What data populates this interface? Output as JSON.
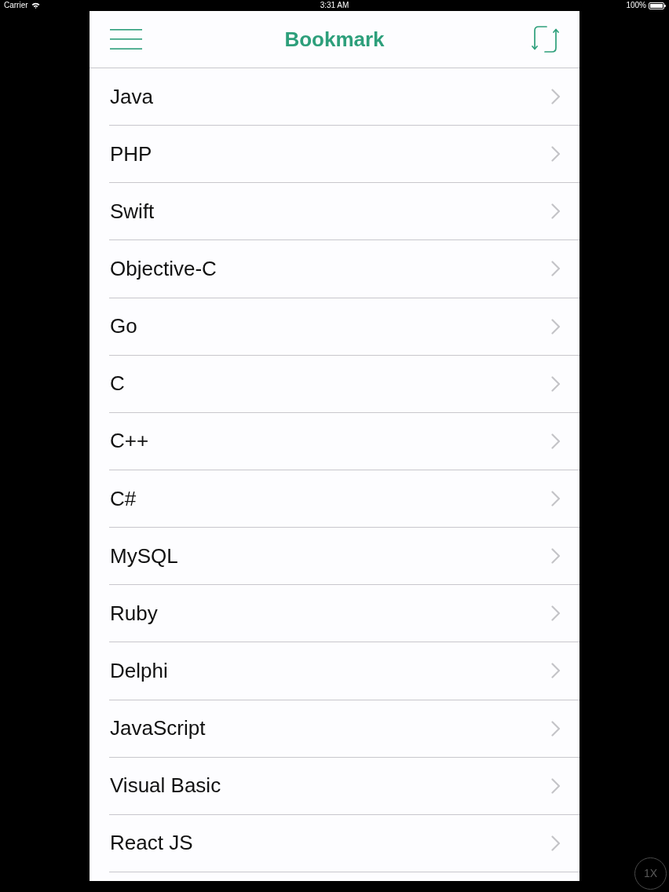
{
  "status_bar": {
    "carrier": "Carrier",
    "time": "3:31 AM",
    "battery": "100%"
  },
  "nav_bar": {
    "title": "Bookmark"
  },
  "items": [
    {
      "label": "Java"
    },
    {
      "label": "PHP"
    },
    {
      "label": "Swift"
    },
    {
      "label": "Objective-C"
    },
    {
      "label": "Go"
    },
    {
      "label": "C"
    },
    {
      "label": "C++"
    },
    {
      "label": "C#"
    },
    {
      "label": "MySQL"
    },
    {
      "label": "Ruby"
    },
    {
      "label": "Delphi"
    },
    {
      "label": "JavaScript"
    },
    {
      "label": "Visual Basic"
    },
    {
      "label": "React JS"
    }
  ],
  "zoom_button": {
    "label": "1X"
  }
}
